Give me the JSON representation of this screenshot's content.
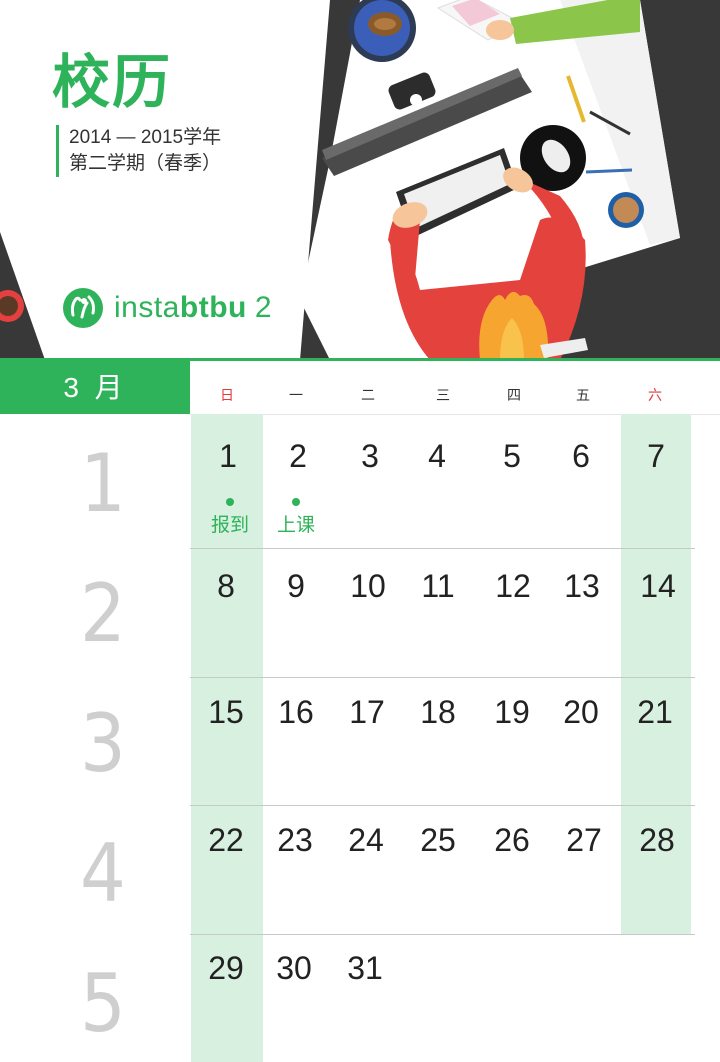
{
  "header": {
    "title": "校历",
    "year_line": "2014 — 2015学年",
    "term_line": "第二学期（春季）",
    "brand_name_light": "insta",
    "brand_name_bold": "btbu",
    "brand_number": "2"
  },
  "month": {
    "label": "3 月",
    "weekdays": [
      "日",
      "一",
      "二",
      "三",
      "四",
      "五",
      "六"
    ]
  },
  "calendar": {
    "week_numbers": [
      "1",
      "2",
      "3",
      "4",
      "5"
    ],
    "weeks": [
      [
        "1",
        "2",
        "3",
        "4",
        "5",
        "6",
        "7"
      ],
      [
        "8",
        "9",
        "10",
        "11",
        "12",
        "13",
        "14"
      ],
      [
        "15",
        "16",
        "17",
        "18",
        "19",
        "20",
        "21"
      ],
      [
        "22",
        "23",
        "24",
        "25",
        "26",
        "27",
        "28"
      ],
      [
        "29",
        "30",
        "31",
        "",
        "",
        "",
        ""
      ]
    ],
    "events": [
      {
        "day": "1",
        "label": "报到"
      },
      {
        "day": "2",
        "label": "上课"
      }
    ]
  },
  "colors": {
    "accent": "#2fb35a",
    "weekend_bg": "#d8f0df",
    "sunday_saturday_label": "#e03b3b",
    "week_number_gray": "#cfcfcf"
  },
  "icons": [
    "instabtbu-logo-icon",
    "desk-illustration"
  ]
}
